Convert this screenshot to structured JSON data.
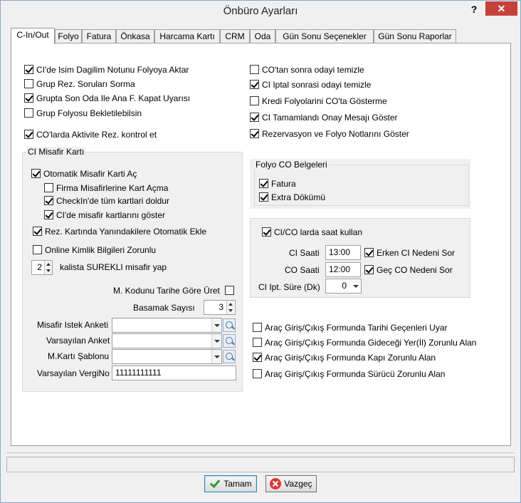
{
  "window": {
    "title": "Önbüro Ayarları",
    "help": "?",
    "close": "✕"
  },
  "tabs": [
    "C-In/Out",
    "Folyo",
    "Fatura",
    "Önkasa",
    "Harcama Kartı",
    "CRM",
    "Oda",
    "Gün Sonu Seçenekler",
    "Gün Sonu Raporlar"
  ],
  "left_checks": [
    {
      "label": "CI'de Isim Dagilim Notunu Folyoya Aktar",
      "checked": true
    },
    {
      "label": "Grup Rez. Soruları Sorma",
      "checked": false
    },
    {
      "label": "Grupta Son Oda Ile Ana F. Kapat Uyarısı",
      "checked": true
    },
    {
      "label": "Grup Folyosu Bekletilebilsin",
      "checked": false
    },
    {
      "label": "CO'larda Aktivite Rez. kontrol et",
      "checked": true
    }
  ],
  "right_checks": [
    {
      "label": "CO'tan sonra odayi temizle",
      "checked": false
    },
    {
      "label": "CI Iptal sonrasi odayi temizle",
      "checked": true
    },
    {
      "label": "Kredi Folyolarini CO'ta Gösterme",
      "checked": false
    },
    {
      "label": "CI Tamamlandı Onay Mesajı Göster",
      "checked": true
    },
    {
      "label": "Rezervasyon ve Folyo Notlarını Göster",
      "checked": true
    }
  ],
  "ci_card": {
    "title": "CI Misafir Kartı",
    "auto_card": {
      "label": "Otomatik Misafir Karti Aç",
      "checked": true
    },
    "firm_guest": {
      "label": "Firma Misafirlerine Kart Açma",
      "checked": false
    },
    "checkin_fill": {
      "label": "CheckIn'de tüm kartlari doldur",
      "checked": true
    },
    "ci_show": {
      "label": "CI'de misafir kartlarını göster",
      "checked": true
    },
    "rez_card": {
      "label": "Rez. Kartında Yanındakilere Otomatik Ekle",
      "checked": true
    },
    "online_id": {
      "label": "Online Kimlik Bilgileri Zorunlu",
      "checked": false
    },
    "spin_value": "2",
    "spin_label": "kalista SUREKLI misafir yap",
    "m_code": {
      "label": "M. Kodunu Tarihe Göre Üret",
      "checked": false
    },
    "digits_label": "Basamak Sayısı",
    "digits_value": "3",
    "req_label": "Misafir Istek Anketi",
    "survey_label": "Varsayılan Anket",
    "template_label": "M.Kartı Şablonu",
    "tax_label": "Varsayılan VergiNo",
    "tax_value": "11111111111"
  },
  "folio_co": {
    "title": "Folyo CO Belgeleri",
    "invoice": {
      "label": "Fatura",
      "checked": true
    },
    "extra": {
      "label": "Extra Dökümü",
      "checked": true
    }
  },
  "cico": {
    "use_time": {
      "label": "CI/CO larda saat kullan",
      "checked": true
    },
    "ci_time_label": "CI Saati",
    "ci_time": "13:00",
    "early_reason": {
      "label": "Erken CI Nedeni Sor",
      "checked": true
    },
    "co_time_label": "CO Saati",
    "co_time": "12:00",
    "late_reason": {
      "label": "Geç CO Nedeni Sor",
      "checked": true
    },
    "cancel_label": "CI Ipt. Süre (Dk)",
    "cancel_value": "0"
  },
  "vehicle_checks": [
    {
      "label": "Araç Giriş/Çıkış Formunda Tarihi Geçenleri Uyar",
      "checked": false
    },
    {
      "label": "Araç Giriş/Çıkış Formunda Gideceği Yer(İl) Zorunlu Alan",
      "checked": false
    },
    {
      "label": "Araç Giriş/Çıkış Formunda Kapı Zorunlu Alan",
      "checked": true
    },
    {
      "label": "Araç Giriş/Çıkış Formunda Sürücü Zorunlu Alan",
      "checked": false
    }
  ],
  "buttons": {
    "ok": "Tamam",
    "cancel": "Vazgeç"
  }
}
